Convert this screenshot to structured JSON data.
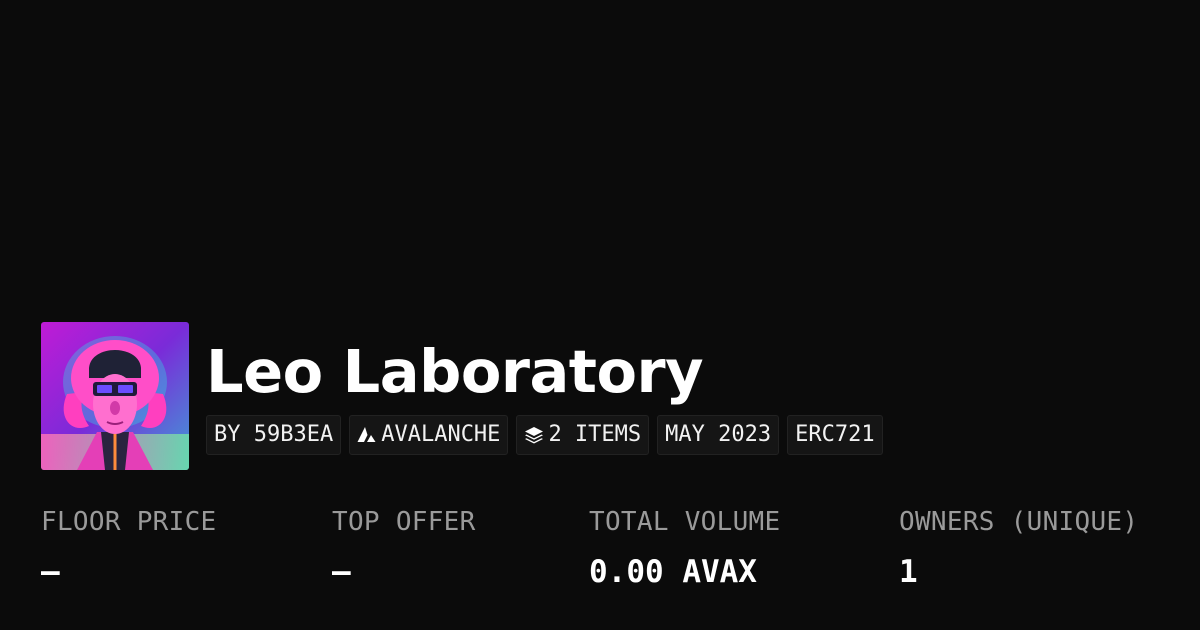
{
  "collection": {
    "name": "Leo Laboratory",
    "chips": [
      {
        "icon": "",
        "text": "BY 59B3EA"
      },
      {
        "icon": "avalanche-icon",
        "text": "AVALANCHE"
      },
      {
        "icon": "layers-icon",
        "text": "2 ITEMS"
      },
      {
        "icon": "",
        "text": "MAY 2023"
      },
      {
        "icon": "",
        "text": "ERC721"
      }
    ]
  },
  "stats": [
    {
      "label": "FLOOR PRICE",
      "value": "–"
    },
    {
      "label": "TOP OFFER",
      "value": "–"
    },
    {
      "label": "TOTAL VOLUME",
      "value": "0.00 AVAX"
    },
    {
      "label": "OWNERS (UNIQUE)",
      "value": "1"
    }
  ],
  "colors": {
    "background": "#0b0b0b",
    "chip_background": "#151515",
    "label": "#9a9a9a",
    "text": "#ffffff"
  }
}
